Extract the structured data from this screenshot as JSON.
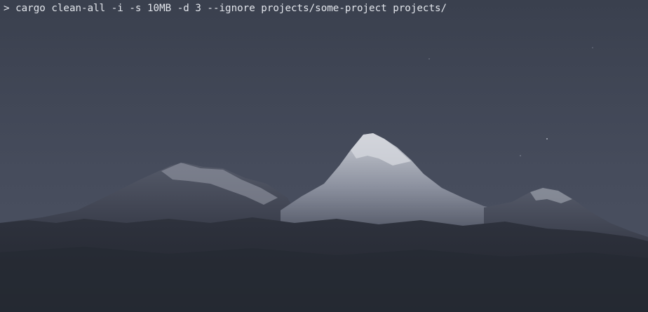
{
  "terminal": {
    "prompt_symbol": ">",
    "command": "cargo clean-all -i -s 10MB -d 3 --ignore projects/some-project projects/"
  },
  "background": {
    "description_icon": "mountain-wallpaper",
    "sky_color": "#3f4552",
    "mountain_color": "#2b2f3a",
    "snow_color": "#b8bcc6"
  }
}
